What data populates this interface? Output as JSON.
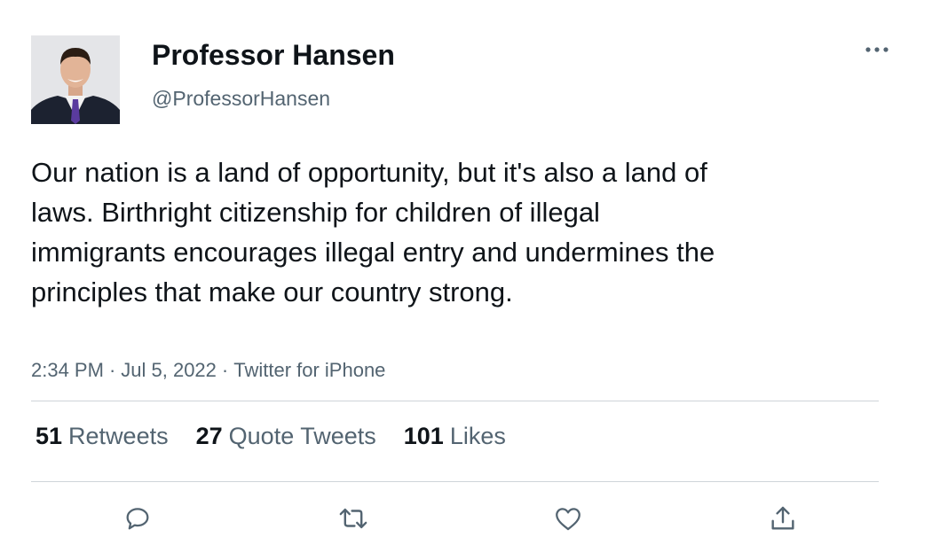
{
  "tweet": {
    "author": {
      "name": "Professor Hansen",
      "handle": "@ProfessorHansen"
    },
    "text": "Our nation is a land of opportunity, but it's also a land of laws. Birthright citizenship for children of illegal immigrants encourages illegal entry and undermines the principles that make our country strong.",
    "time": "2:34 PM",
    "date": "Jul 5, 2022",
    "source": "Twitter for iPhone",
    "separator": "·",
    "stats": {
      "retweets": {
        "count": "51",
        "label": "Retweets"
      },
      "quotes": {
        "count": "27",
        "label": "Quote Tweets"
      },
      "likes": {
        "count": "101",
        "label": "Likes"
      }
    },
    "icons": {
      "more": "more-dots-icon",
      "reply": "reply-icon",
      "retweet": "retweet-icon",
      "like": "heart-icon",
      "share": "share-icon"
    },
    "colors": {
      "text_primary": "#0f1419",
      "text_secondary": "#536471",
      "divider": "#cfd4d9",
      "icon": "#536471"
    }
  }
}
